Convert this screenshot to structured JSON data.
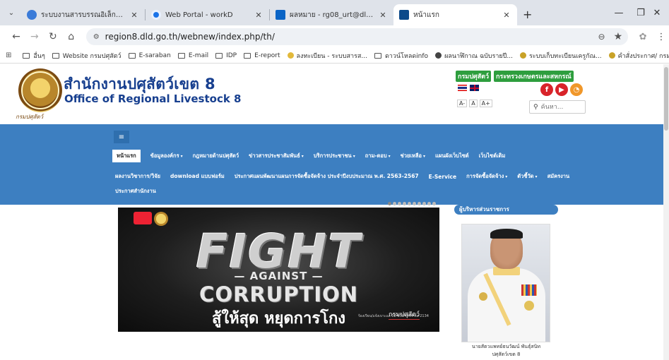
{
  "browser": {
    "tabs": [
      {
        "title": "ระบบงานสารบรรณอิเล็กทรอนิกส์ - ",
        "favicon_color": "#3b7bd8",
        "active": false
      },
      {
        "title": "Web Portal - workD",
        "favicon_color": "#1a73e8",
        "active": false
      },
      {
        "title": "ผลหมาย - rg08_urt@dld.go.th",
        "favicon_color": "#0a64c6",
        "active": false
      },
      {
        "title": "หน้าแรก",
        "favicon_color": "#0d4a8a",
        "active": true
      }
    ],
    "url": "region8.dld.go.th/webnew/index.php/th/",
    "bookmarks": [
      {
        "label": "อื่นๆ",
        "kind": "folder"
      },
      {
        "label": "Website กรมปศุสัตว์",
        "kind": "folder"
      },
      {
        "label": "E-saraban",
        "kind": "folder"
      },
      {
        "label": "E-mail",
        "kind": "folder"
      },
      {
        "label": "IDP",
        "kind": "folder"
      },
      {
        "label": "E-report",
        "kind": "folder"
      },
      {
        "label": "ลงทะเบียน - ระบบสารส...",
        "kind": "site",
        "color": "#e2b93b"
      },
      {
        "label": "ดาวน์โหลดinfo",
        "kind": "folder"
      },
      {
        "label": "ผลนาฬิกาณ ฉบับรายปี...",
        "kind": "site",
        "color": "#444444"
      },
      {
        "label": "ระบบเก็บทะเบียนเครูกัณ...",
        "kind": "site",
        "color": "#c9a227"
      },
      {
        "label": "คำสั่งประกาศ/ กรมปศุสั...",
        "kind": "site",
        "color": "#c9a227"
      }
    ]
  },
  "site": {
    "org_thai": "สำนักงานปศุสัตว์เขต 8",
    "org_eng": "Office of Regional Livestock 8",
    "seal_caption": "กรมปศุสัตว์",
    "header_links": [
      "กรมปศุสัตว์",
      "กระทรวงเกษตรและสหกรณ์"
    ],
    "font_sizes": [
      "A-",
      "A",
      "A+"
    ],
    "social": [
      {
        "label": "f",
        "name": "facebook-icon"
      },
      {
        "label": "▶",
        "name": "youtube-icon"
      },
      {
        "label": "◔",
        "name": "rss-icon"
      }
    ],
    "search_placeholder": "ค้นหา...",
    "nav_rows": [
      [
        {
          "label": "หน้าแรก",
          "active": true,
          "caret": false
        },
        {
          "label": "ข้อมูลองค์กร",
          "caret": true
        },
        {
          "label": "กฎหมายด้านปศุสัตว์",
          "caret": false
        },
        {
          "label": "ข่าวสารประชาสัมพันธ์",
          "caret": true
        },
        {
          "label": "บริการประชาชน",
          "caret": true
        },
        {
          "label": "ถาม-ตอบ",
          "caret": true
        },
        {
          "label": "ช่วยเหลือ",
          "caret": true
        },
        {
          "label": "แผนผังเว็บไซต์",
          "caret": false
        },
        {
          "label": "เว็บไซต์เดิม",
          "caret": false
        }
      ],
      [
        {
          "label": "ผลงานวิชาการ/วิจัย",
          "caret": false
        },
        {
          "label": "download แบบฟอร์ม",
          "caret": false
        },
        {
          "label": "ประกาศแผนพัฒนาแผนการจัดซื้อจัดจ้าง ประจำปีงบประมาณ พ.ศ. 2563-2567",
          "caret": false
        },
        {
          "label": "E-Service",
          "caret": false
        },
        {
          "label": "การจัดซื้อจัดจ้าง",
          "caret": true
        },
        {
          "label": "ตัวชี้วัด",
          "caret": true
        },
        {
          "label": "สมัครงาน",
          "caret": false
        }
      ],
      [
        {
          "label": "ประกาศสำนักงาน",
          "caret": false
        }
      ]
    ],
    "carousel_dots": 10,
    "carousel_active": 0,
    "banner": {
      "headline": "FIGHT",
      "against": "— AGAINST —",
      "corruption": "CORRUPTION",
      "slogan": "สู้ให้สุด หยุดการโกง",
      "dept": "กรมปศุสัตว์",
      "contact": "ร้องเรียน/แจ้งเบาะแส 02-6534444 ต่อ 2134"
    },
    "executive": {
      "heading": "ผู้บริหารส่วนราชการ",
      "name_line1": "นายสัตวแพทย์ธนวัฒน์ พันธุ์สนิท",
      "name_line2": "ปศุสัตว์เขต 8"
    }
  }
}
